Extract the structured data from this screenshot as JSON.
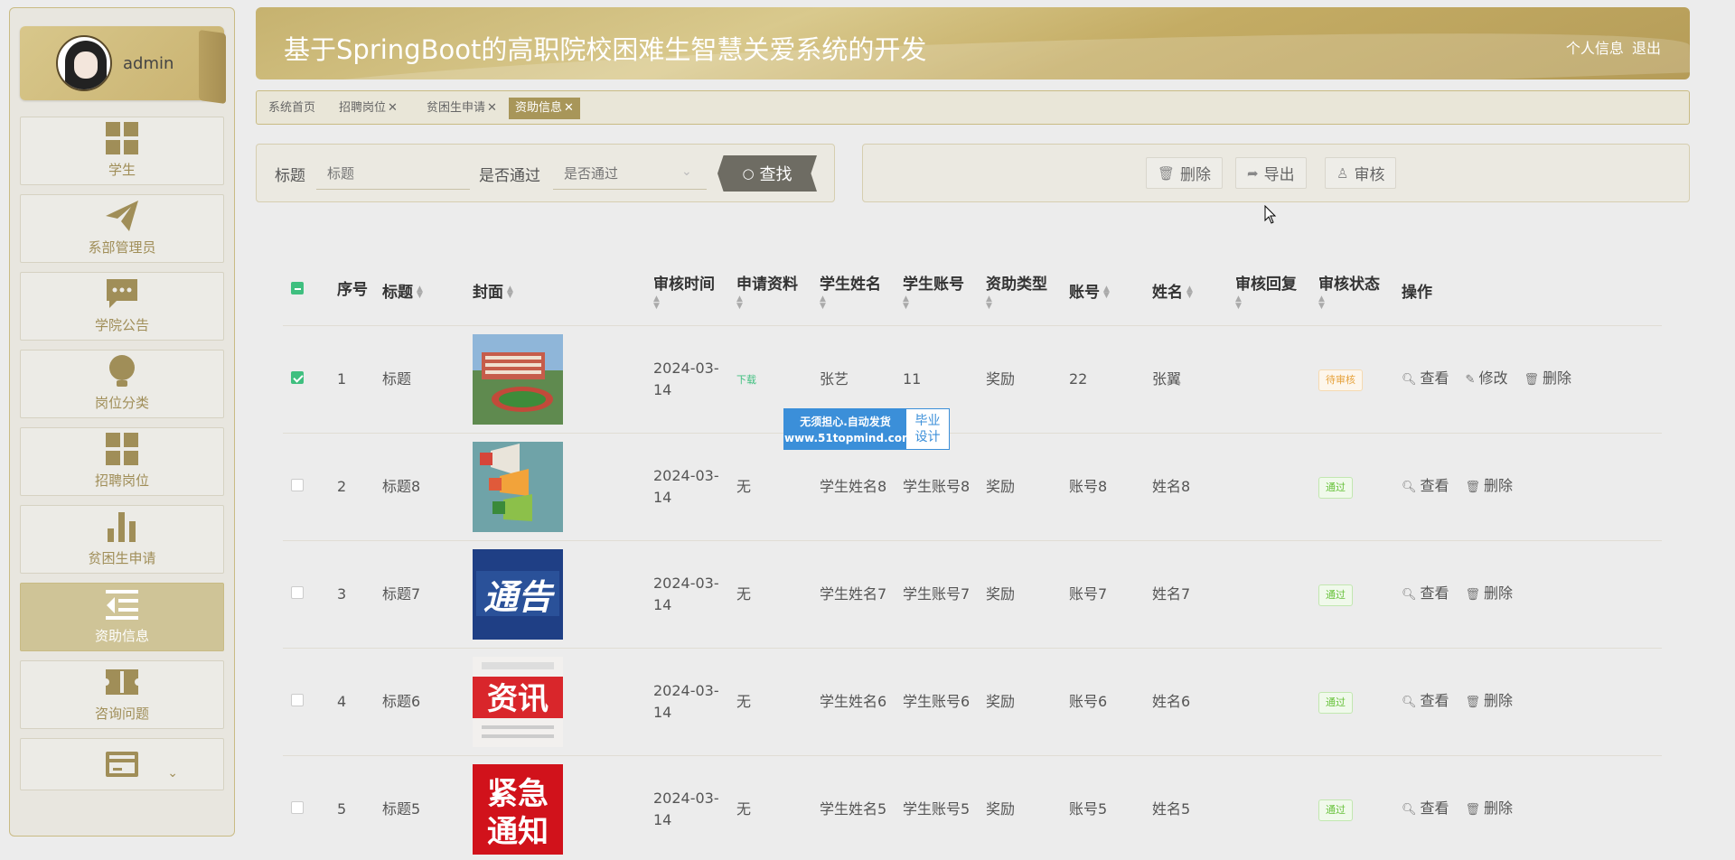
{
  "sidebar": {
    "user": {
      "name": "admin"
    },
    "items": [
      {
        "label": "学生",
        "icon": "grid-icon"
      },
      {
        "label": "系部管理员",
        "icon": "paper-plane-icon"
      },
      {
        "label": "学院公告",
        "icon": "chat-bubble-icon"
      },
      {
        "label": "岗位分类",
        "icon": "lightbulb-icon"
      },
      {
        "label": "招聘岗位",
        "icon": "grid-icon"
      },
      {
        "label": "贫困生申请",
        "icon": "bar-chart-icon"
      },
      {
        "label": "资助信息",
        "icon": "list-indent-icon"
      },
      {
        "label": "咨询问题",
        "icon": "ticket-icon"
      }
    ],
    "more_icon": "card-icon",
    "chevron": "⌄"
  },
  "header": {
    "title": "基于SpringBoot的高职院校困难生智慧关爱系统的开发",
    "profile_link": "个人信息",
    "logout_link": "退出"
  },
  "tabs": [
    {
      "label": "系统首页"
    },
    {
      "label": "招聘岗位"
    },
    {
      "label": "贫困生申请"
    },
    {
      "label": "资助信息"
    }
  ],
  "search": {
    "title_label": "标题",
    "title_placeholder": "标题",
    "pass_label": "是否通过",
    "pass_placeholder": "是否通过",
    "search_button": "查找"
  },
  "actions": {
    "delete": "删除",
    "export": "导出",
    "review": "审核"
  },
  "table": {
    "headers": {
      "index": "序号",
      "title": "标题",
      "cover": "封面",
      "review_time": "审核时间",
      "material": "申请资料",
      "student_name": "学生姓名",
      "student_account": "学生账号",
      "aid_type": "资助类型",
      "account": "账号",
      "name": "姓名",
      "reply": "审核回复",
      "status": "审核状态",
      "ops": "操作"
    },
    "rows": [
      {
        "index": "1",
        "title": "标题",
        "review_time": "2024-03-14",
        "material": "下载",
        "student_name": "张艺",
        "student_account": "11",
        "aid_type": "奖励",
        "account": "22",
        "name": "张翼",
        "reply": "",
        "status": "待审核",
        "checked": true,
        "cover": "campus"
      },
      {
        "index": "2",
        "title": "标题8",
        "review_time": "2024-03-14",
        "material": "无",
        "student_name": "学生姓名8",
        "student_account": "学生账号8",
        "aid_type": "奖励",
        "account": "账号8",
        "name": "姓名8",
        "reply": "",
        "status": "通过",
        "checked": false,
        "cover": "megaphones"
      },
      {
        "index": "3",
        "title": "标题7",
        "review_time": "2024-03-14",
        "material": "无",
        "student_name": "学生姓名7",
        "student_account": "学生账号7",
        "aid_type": "奖励",
        "account": "账号7",
        "name": "姓名7",
        "reply": "",
        "status": "通过",
        "checked": false,
        "cover": "notice"
      },
      {
        "index": "4",
        "title": "标题6",
        "review_time": "2024-03-14",
        "material": "无",
        "student_name": "学生姓名6",
        "student_account": "学生账号6",
        "aid_type": "奖励",
        "account": "账号6",
        "name": "姓名6",
        "reply": "",
        "status": "通过",
        "checked": false,
        "cover": "news"
      },
      {
        "index": "5",
        "title": "标题5",
        "review_time": "2024-03-14",
        "material": "无",
        "student_name": "学生姓名5",
        "student_account": "学生账号5",
        "aid_type": "奖励",
        "account": "账号5",
        "name": "姓名5",
        "reply": "",
        "status": "通过",
        "checked": false,
        "cover": "urgent"
      }
    ],
    "cover_texts": {
      "notice": "通告",
      "news": "资讯",
      "urgent_line1": "紧急",
      "urgent_line2": "通知"
    },
    "op_labels": {
      "view": "查看",
      "edit": "修改",
      "delete": "删除"
    }
  },
  "watermark": {
    "line1": "无须担心.自动发货",
    "line2": "www.51topmind.com",
    "right_line1": "毕业",
    "right_line2": "设计"
  },
  "colors": {
    "accent": "#a89659",
    "active_menu": "#cfc497",
    "pass": "#67c23a",
    "pending": "#e6a23c"
  }
}
